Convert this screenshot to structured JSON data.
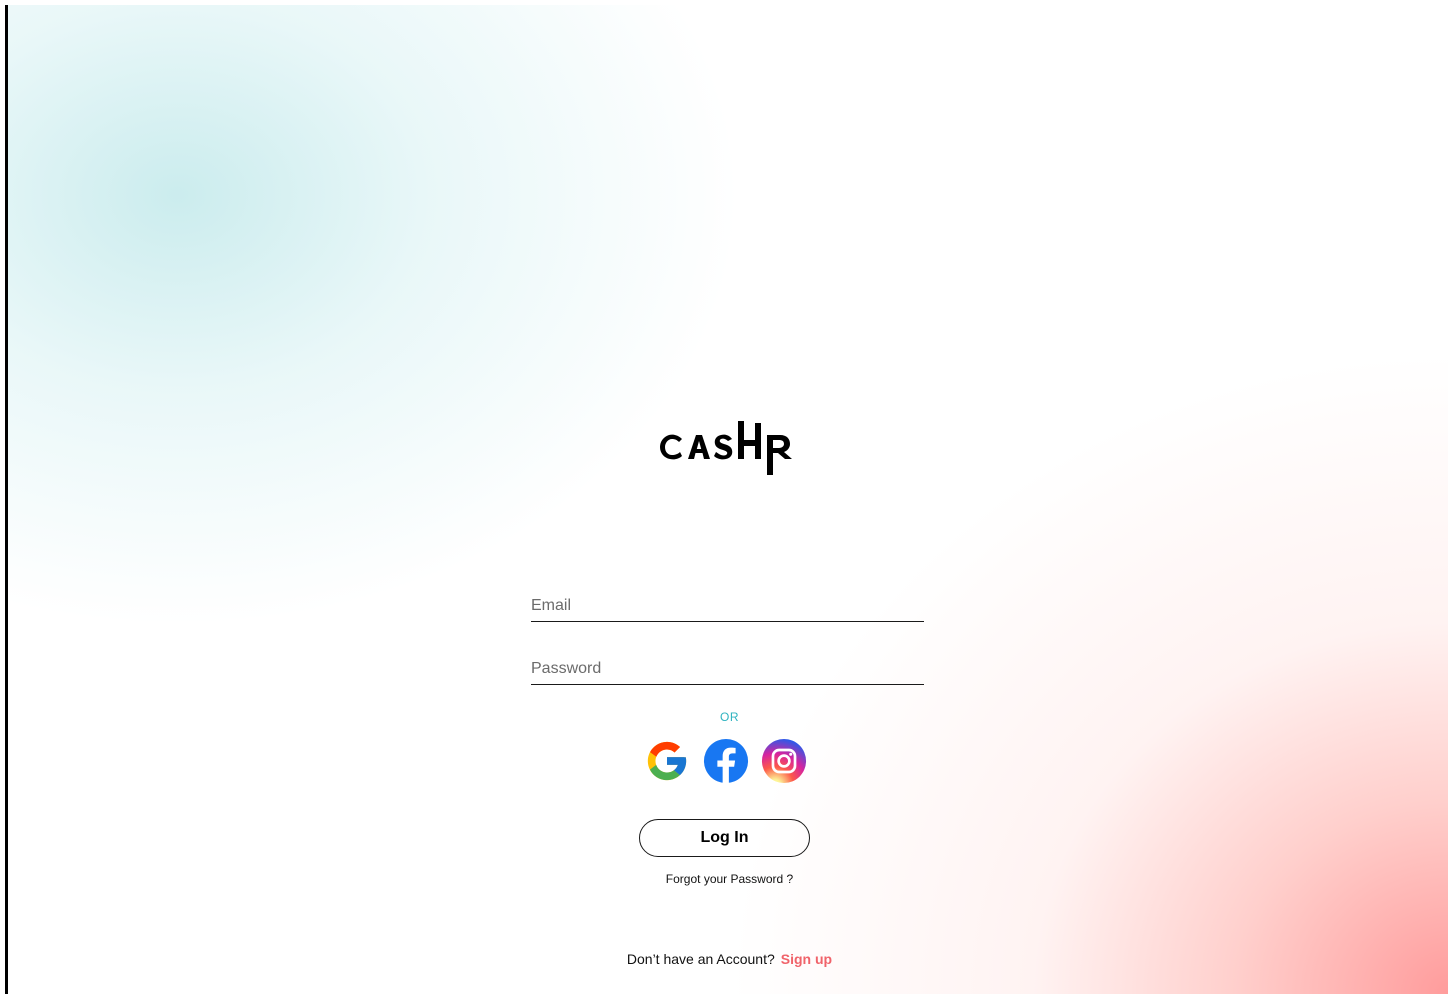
{
  "brand": {
    "logo_text": "CASHR"
  },
  "form": {
    "email_placeholder": "Email",
    "password_placeholder": "Password",
    "or_label": "OR",
    "login_label": "Log In",
    "forgot_label": "Forgot your Password ?"
  },
  "social": {
    "providers": [
      "google-icon",
      "facebook-icon",
      "instagram-icon"
    ]
  },
  "footer": {
    "prompt": "Don’t have an Account?",
    "signup_label": "Sign up"
  },
  "colors": {
    "accent_teal": "#2fb3c0",
    "signup_red": "#f0636a",
    "facebook_blue": "#1877f2",
    "text_dark": "#111111"
  }
}
